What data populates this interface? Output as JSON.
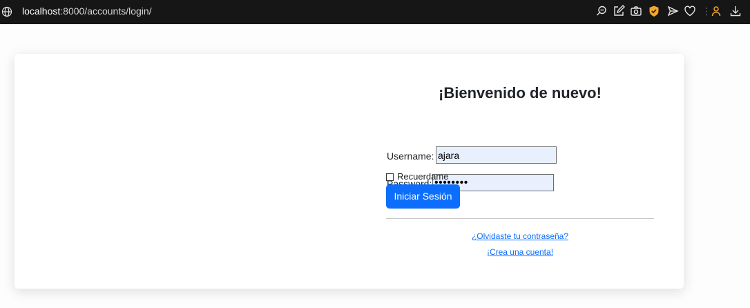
{
  "browser": {
    "url_host": "localhost",
    "url_rest": ":8000/accounts/login/",
    "icons": [
      "globe-icon",
      "zoom-icon",
      "edit-icon",
      "camera-icon",
      "shield-icon",
      "send-icon",
      "heart-icon",
      "more-icon",
      "profile-icon",
      "download-icon"
    ],
    "shield_color": "#f4a62a",
    "profile_color": "#f4a62a"
  },
  "login": {
    "title": "¡Bienvenido de nuevo!",
    "username_label": "Username:",
    "username_value": "ajara",
    "password_label": "Password:",
    "password_value": "••••••••",
    "remember_label": "Recuerdame",
    "remember_checked": false,
    "submit_label": "Iniciar Sesión",
    "forgot_link": "¿Olvidaste tu contraseña?",
    "signup_link": "¡Crea una cuenta!"
  },
  "colors": {
    "primary": "#0d6efd",
    "field_bg": "#e8f0fe"
  }
}
